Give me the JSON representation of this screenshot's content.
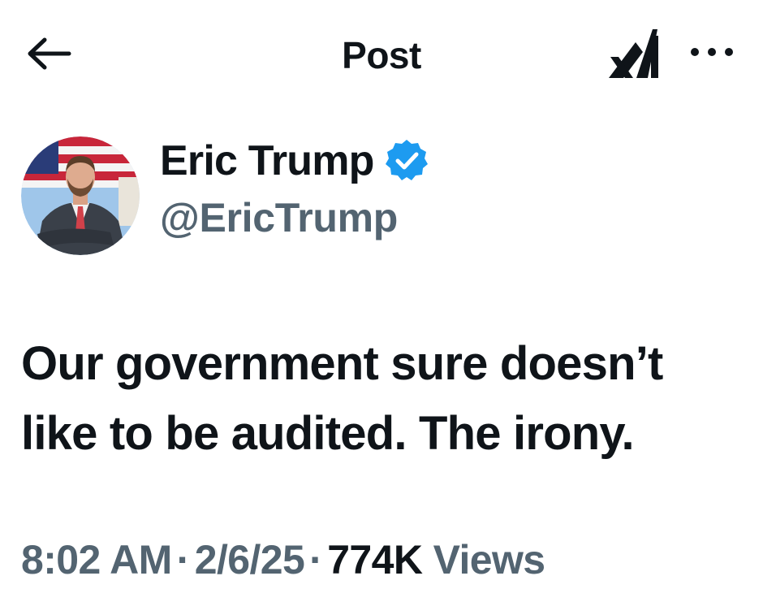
{
  "header": {
    "title": "Post",
    "back_icon": "arrow-left-icon",
    "grok_icon": "grok-logo-icon",
    "more_icon": "more-horizontal-icon"
  },
  "author": {
    "name": "Eric Trump",
    "handle": "@EricTrump",
    "verified_icon": "verified-badge-icon",
    "verified_color": "#1d9bf0"
  },
  "tweet": {
    "line1": "Our government sure doesn’t",
    "line2": "like to be audited. The irony."
  },
  "meta": {
    "time": "8:02 AM",
    "separator": "·",
    "date": "2/6/25",
    "views_count": "774K",
    "views_label": "Views"
  },
  "colors": {
    "text_primary": "#0f1419",
    "text_secondary": "#536471",
    "background": "#ffffff"
  }
}
